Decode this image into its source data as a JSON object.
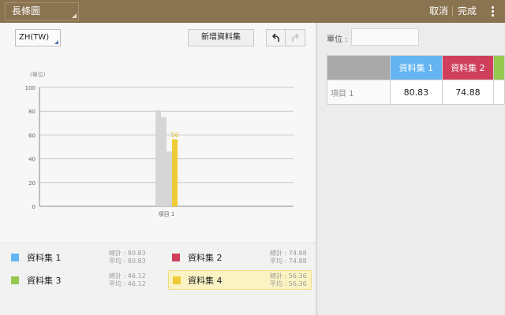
{
  "toolbar": {
    "chart_type": "長條圖",
    "cancel_label": "取消",
    "done_label": "完成"
  },
  "editor": {
    "language": "ZH(TW)",
    "add_dataset_label": "新增資料集"
  },
  "chart_data": {
    "type": "bar",
    "ylabel": "(單位)",
    "ylim": [
      0,
      100
    ],
    "yticks": [
      0,
      20,
      40,
      60,
      80,
      100
    ],
    "categories": [
      "項目 1"
    ],
    "grid": true,
    "highlighted_series": 3,
    "series": [
      {
        "name": "資料集 1",
        "values": [
          80.83
        ],
        "color": "#d6d6d6"
      },
      {
        "name": "資料集 2",
        "values": [
          74.88
        ],
        "color": "#d6d6d6"
      },
      {
        "name": "資料集 3",
        "values": [
          46.12
        ],
        "color": "#d6d6d6"
      },
      {
        "name": "資料集 4",
        "values": [
          56.36
        ],
        "color": "#eecc35"
      }
    ],
    "highlight_label": "56"
  },
  "legend": {
    "items": [
      {
        "name": "資料集 1",
        "color": "#63b4f0",
        "total": "總計 : 80.83",
        "avg": "平均 : 80.83"
      },
      {
        "name": "資料集 2",
        "color": "#cf3f5c",
        "total": "總計 : 74.88",
        "avg": "平均 : 74.88"
      },
      {
        "name": "資料集 3",
        "color": "#95c84e",
        "total": "總計 : 46.12",
        "avg": "平均 : 46.12"
      },
      {
        "name": "資料集 4",
        "color": "#eecc35",
        "total": "總計 : 56.36",
        "avg": "平均 : 56.36"
      }
    ]
  },
  "data_table": {
    "unit_label": "單位 :",
    "unit_value": "",
    "headers": [
      "資料集 1",
      "資料集 2",
      ""
    ],
    "rows": [
      {
        "label": "項目 1",
        "values": [
          "80.83",
          "74.88",
          ""
        ]
      }
    ]
  }
}
